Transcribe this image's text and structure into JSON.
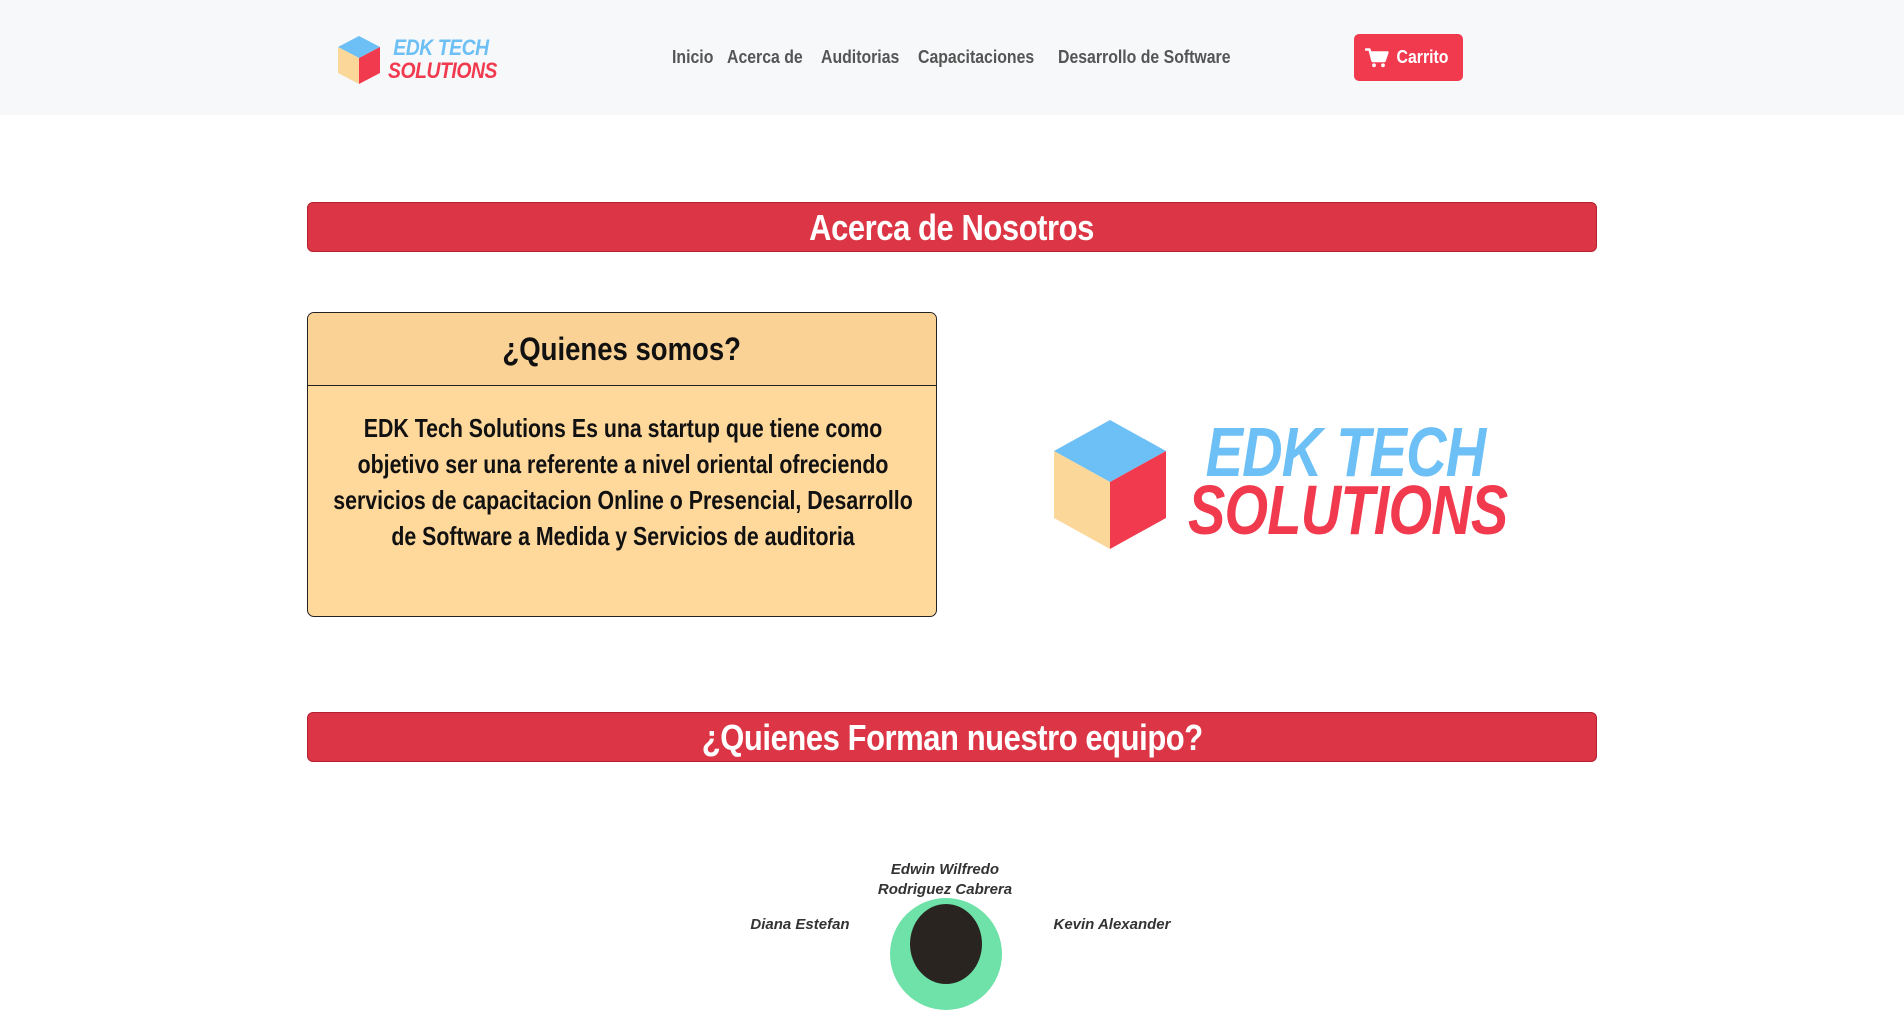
{
  "navbar": {
    "brand": {
      "line1": "EDK TECH",
      "line2": "SOLUTIONS"
    },
    "links": [
      {
        "label": "Inicio"
      },
      {
        "label": "Acerca de"
      },
      {
        "label": "Auditorias"
      },
      {
        "label": "Capacitaciones"
      },
      {
        "label": "Desarrollo de Software"
      }
    ],
    "cart": {
      "label": "Carrito",
      "icon": "shopping-cart-icon"
    }
  },
  "about": {
    "banner": "Acerca de Nosotros",
    "card": {
      "title": "¿Quienes somos?",
      "body": "EDK Tech Solutions Es una startup que tiene como objetivo ser una referente a nivel oriental ofreciendo servicios de capacitacion Online o Presencial, Desarrollo de Software a Medida y Servicios de auditoria"
    },
    "logo": {
      "line1": "EDK TECH",
      "line2": "SOLUTIONS"
    }
  },
  "team": {
    "banner": "¿Quienes Forman nuestro equipo?",
    "members": [
      {
        "name": "Edwin Wilfredo\nRodriguez Cabrera"
      },
      {
        "name": "Diana Estefan"
      },
      {
        "name": "Kevin Alexander"
      }
    ]
  },
  "colors": {
    "brand_red": "#dc3545",
    "brand_blue": "#6cc0f5",
    "card_yellow": "#ffd89b",
    "navbar_bg": "#f7f8fa"
  }
}
